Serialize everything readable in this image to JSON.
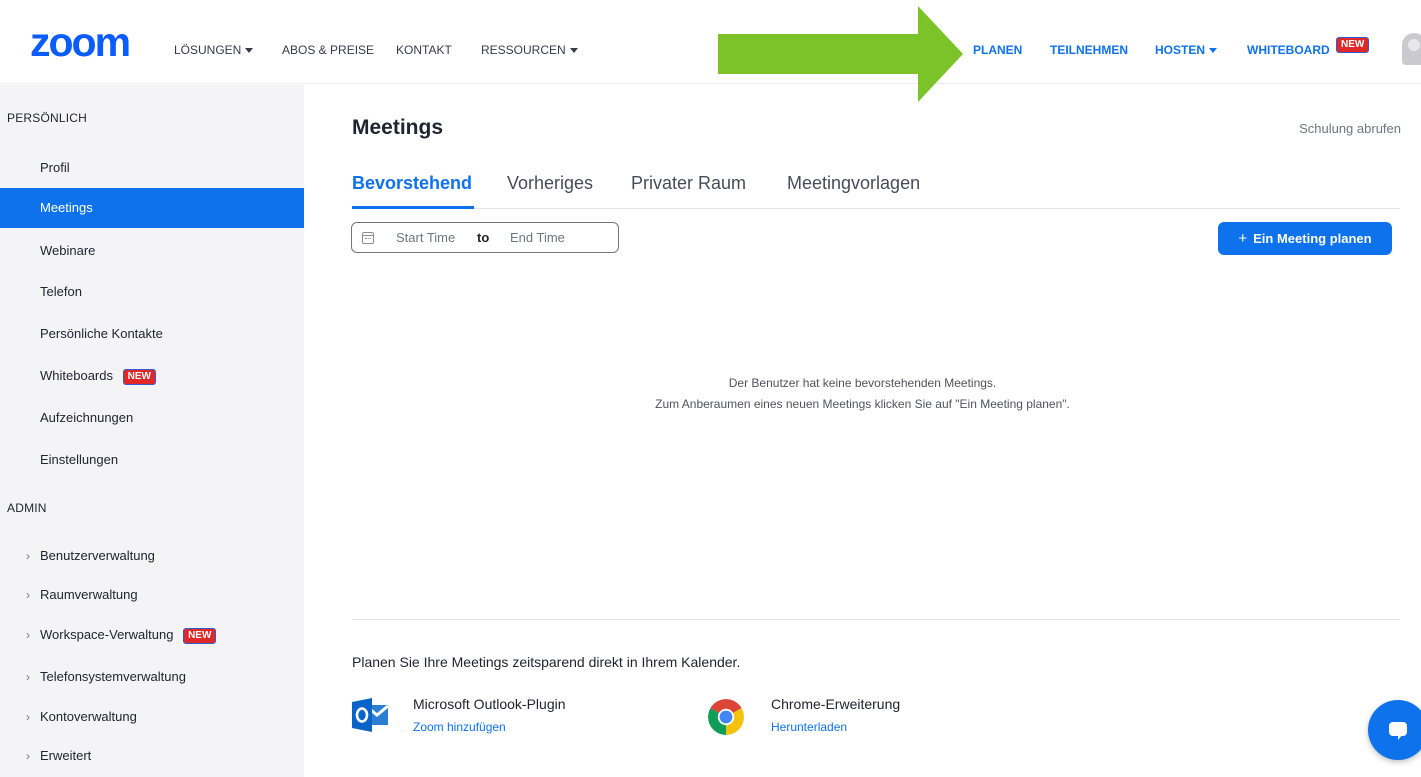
{
  "brand": {
    "logo_text": "zoom",
    "accent": "#0e72ed",
    "logo_color": "#0b5cff",
    "badge_color": "#e02828",
    "arrow_color": "#7cc229"
  },
  "topnav": {
    "left_items": [
      {
        "label": "LÖSUNGEN",
        "has_caret": true
      },
      {
        "label": "ABOS & PREISE",
        "has_caret": false
      },
      {
        "label": "KONTAKT",
        "has_caret": false
      },
      {
        "label": "RESSOURCEN",
        "has_caret": true
      }
    ],
    "right_items": [
      {
        "label": "PLANEN"
      },
      {
        "label": "TEILNEHMEN"
      },
      {
        "label": "HOSTEN",
        "has_caret": true
      },
      {
        "label": "WHITEBOARD",
        "badge": "NEW"
      }
    ],
    "avatar_icon": "user-avatar-icon"
  },
  "sidebar": {
    "personal_heading": "PERSÖNLICH",
    "personal_items": [
      {
        "label": "Profil"
      },
      {
        "label": "Meetings",
        "active": true
      },
      {
        "label": "Webinare"
      },
      {
        "label": "Telefon"
      },
      {
        "label": "Persönliche Kontakte"
      },
      {
        "label": "Whiteboards",
        "badge": "NEW"
      },
      {
        "label": "Aufzeichnungen"
      },
      {
        "label": "Einstellungen"
      }
    ],
    "admin_heading": "ADMIN",
    "admin_items": [
      {
        "label": "Benutzerverwaltung"
      },
      {
        "label": "Raumverwaltung"
      },
      {
        "label": "Workspace-Verwaltung",
        "badge": "NEW"
      },
      {
        "label": "Telefonsystemverwaltung"
      },
      {
        "label": "Kontoverwaltung"
      },
      {
        "label": "Erweitert"
      }
    ]
  },
  "main": {
    "title": "Meetings",
    "training_link": "Schulung abrufen",
    "tabs": [
      {
        "label": "Bevorstehend",
        "active": true
      },
      {
        "label": "Vorheriges"
      },
      {
        "label": "Privater Raum"
      },
      {
        "label": "Meetingvorlagen"
      }
    ],
    "date_range": {
      "start_placeholder": "Start Time",
      "separator": "to",
      "end_placeholder": "End Time"
    },
    "schedule_button": {
      "icon": "+",
      "label": "Ein Meeting planen"
    },
    "empty_state": {
      "line1": "Der Benutzer hat keine bevorstehenden Meetings.",
      "line2": "Zum Anberaumen eines neuen Meetings klicken Sie auf \"Ein Meeting planen\"."
    },
    "calendar_hint": "Planen Sie Ihre Meetings zeitsparend direkt in Ihrem Kalender.",
    "plugins": [
      {
        "name": "Microsoft Outlook-Plugin",
        "link": "Zoom hinzufügen",
        "icon": "outlook-icon"
      },
      {
        "name": "Chrome-Erweiterung",
        "link": "Herunterladen",
        "icon": "chrome-icon"
      }
    ]
  },
  "chat_widget": {
    "icon": "chat-bubble-icon"
  }
}
